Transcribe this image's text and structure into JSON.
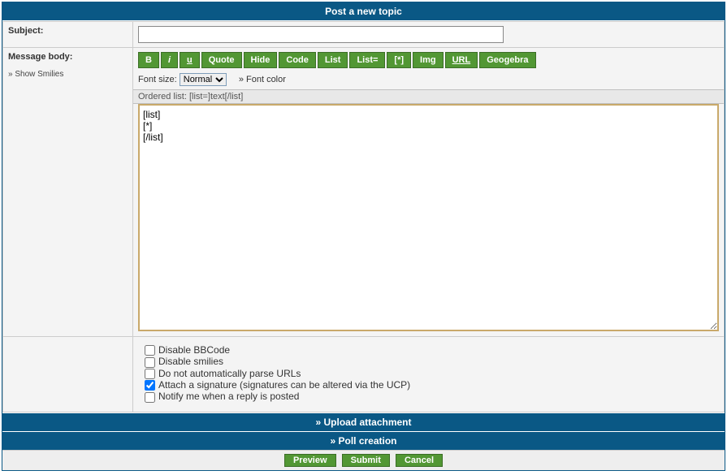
{
  "header": {
    "title": "Post a new topic"
  },
  "subject": {
    "label": "Subject:",
    "value": ""
  },
  "body": {
    "label": "Message body:",
    "smilies_link": "Show Smilies",
    "bbcode_buttons": {
      "bold": "B",
      "italic": "i",
      "underline": "u",
      "quote": "Quote",
      "hide": "Hide",
      "code": "Code",
      "list": "List",
      "liste": "List=",
      "star": "[*]",
      "img": "Img",
      "url": "URL",
      "geo": "Geogebra"
    },
    "font_size_label": "Font size:",
    "font_size_value": "Normal",
    "font_color_label": "Font color",
    "tip": "Ordered list: [list=]text[/list]",
    "textarea": "[list]\n[*]\n[/list]"
  },
  "options": [
    {
      "label": "Disable BBCode",
      "checked": false
    },
    {
      "label": "Disable smilies",
      "checked": false
    },
    {
      "label": "Do not automatically parse URLs",
      "checked": false
    },
    {
      "label": "Attach a signature (signatures can be altered via the UCP)",
      "checked": true
    },
    {
      "label": "Notify me when a reply is posted",
      "checked": false
    }
  ],
  "bars": {
    "upload": "Upload attachment",
    "poll": "Poll creation"
  },
  "submit": {
    "preview": "Preview",
    "submit": "Submit",
    "cancel": "Cancel"
  }
}
